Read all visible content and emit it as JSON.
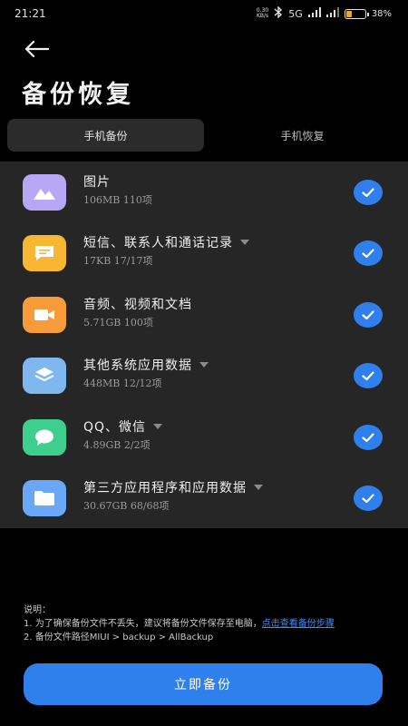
{
  "status_bar": {
    "time": "21:21",
    "net_speed_value": "0.30",
    "net_speed_unit": "KB/s",
    "network_label": "5G",
    "battery_percent": "38%",
    "battery_level": 0.38,
    "battery_color": "#f5a623"
  },
  "header": {
    "title": "备份恢复",
    "back_icon": "arrow-left-icon"
  },
  "tabs": [
    {
      "label": "手机备份",
      "active": true
    },
    {
      "label": "手机恢复",
      "active": false
    }
  ],
  "items": [
    {
      "title": "图片",
      "sub": "106MB  110项",
      "icon": "image-icon",
      "color": "#b6a8f5",
      "has_caret": false,
      "checked": true
    },
    {
      "title": "短信、联系人和通话记录",
      "sub": "17KB  17/17项",
      "icon": "message-icon",
      "color": "#f7b733",
      "has_caret": true,
      "checked": true
    },
    {
      "title": "音频、视频和文档",
      "sub": "5.71GB  100项",
      "icon": "video-icon",
      "color": "#f89b3a",
      "has_caret": false,
      "checked": true
    },
    {
      "title": "其他系统应用数据",
      "sub": "448MB  12/12项",
      "icon": "layers-icon",
      "color": "#7fb8ef",
      "has_caret": true,
      "checked": true
    },
    {
      "title": "QQ、微信",
      "sub": "4.89GB  2/2项",
      "icon": "chat-bubble-icon",
      "color": "#3ecf8e",
      "has_caret": true,
      "checked": true
    },
    {
      "title": "第三方应用程序和应用数据",
      "sub": "30.67GB  68/68项",
      "icon": "folder-icon",
      "color": "#6aa8f7",
      "has_caret": true,
      "checked": true
    }
  ],
  "notes": {
    "heading": "说明：",
    "line1_prefix": "1. 为了确保备份文件不丢失，建议将备份文件保存至电脑，",
    "line1_link": "点击查看备份步骤",
    "line2": "2. 备份文件路径MIUI > backup > AllBackup"
  },
  "action": {
    "label": "立即备份"
  },
  "colors": {
    "accent": "#2f80ed",
    "list_bg": "#262626"
  }
}
